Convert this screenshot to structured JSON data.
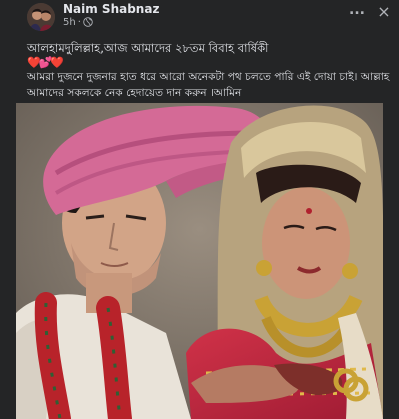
{
  "post": {
    "author": "Naim Shabnaz",
    "time": "5h",
    "separator": "·",
    "privacy_icon": "globe-icon",
    "more_icon": "more-icon",
    "close_icon": "close-icon",
    "more_label": "...",
    "close_label": "×",
    "line1": "আলহামদুলিল্লাহ,আজ আমাদের ২৮তম বিবাহ বার্ষিকী",
    "hearts": "❤️💕❤️",
    "line2": "আমরা দুজনে দুজনার হাত ধরে আরো অনেকটা পথ চলতে পারি এই দোয়া চাই। আল্লাহ",
    "line3": "আমাদের সকলকে নেক হেদায়েত দান করুন ।আমিন"
  },
  "colors": {
    "background": "#242526",
    "text": "#e4e6eb",
    "secondary": "#b0b3b8",
    "heart": "#f02849",
    "turban": "#d46a96",
    "garland": "#b8232a",
    "sari": "#c0233c",
    "gold": "#c9a235"
  }
}
